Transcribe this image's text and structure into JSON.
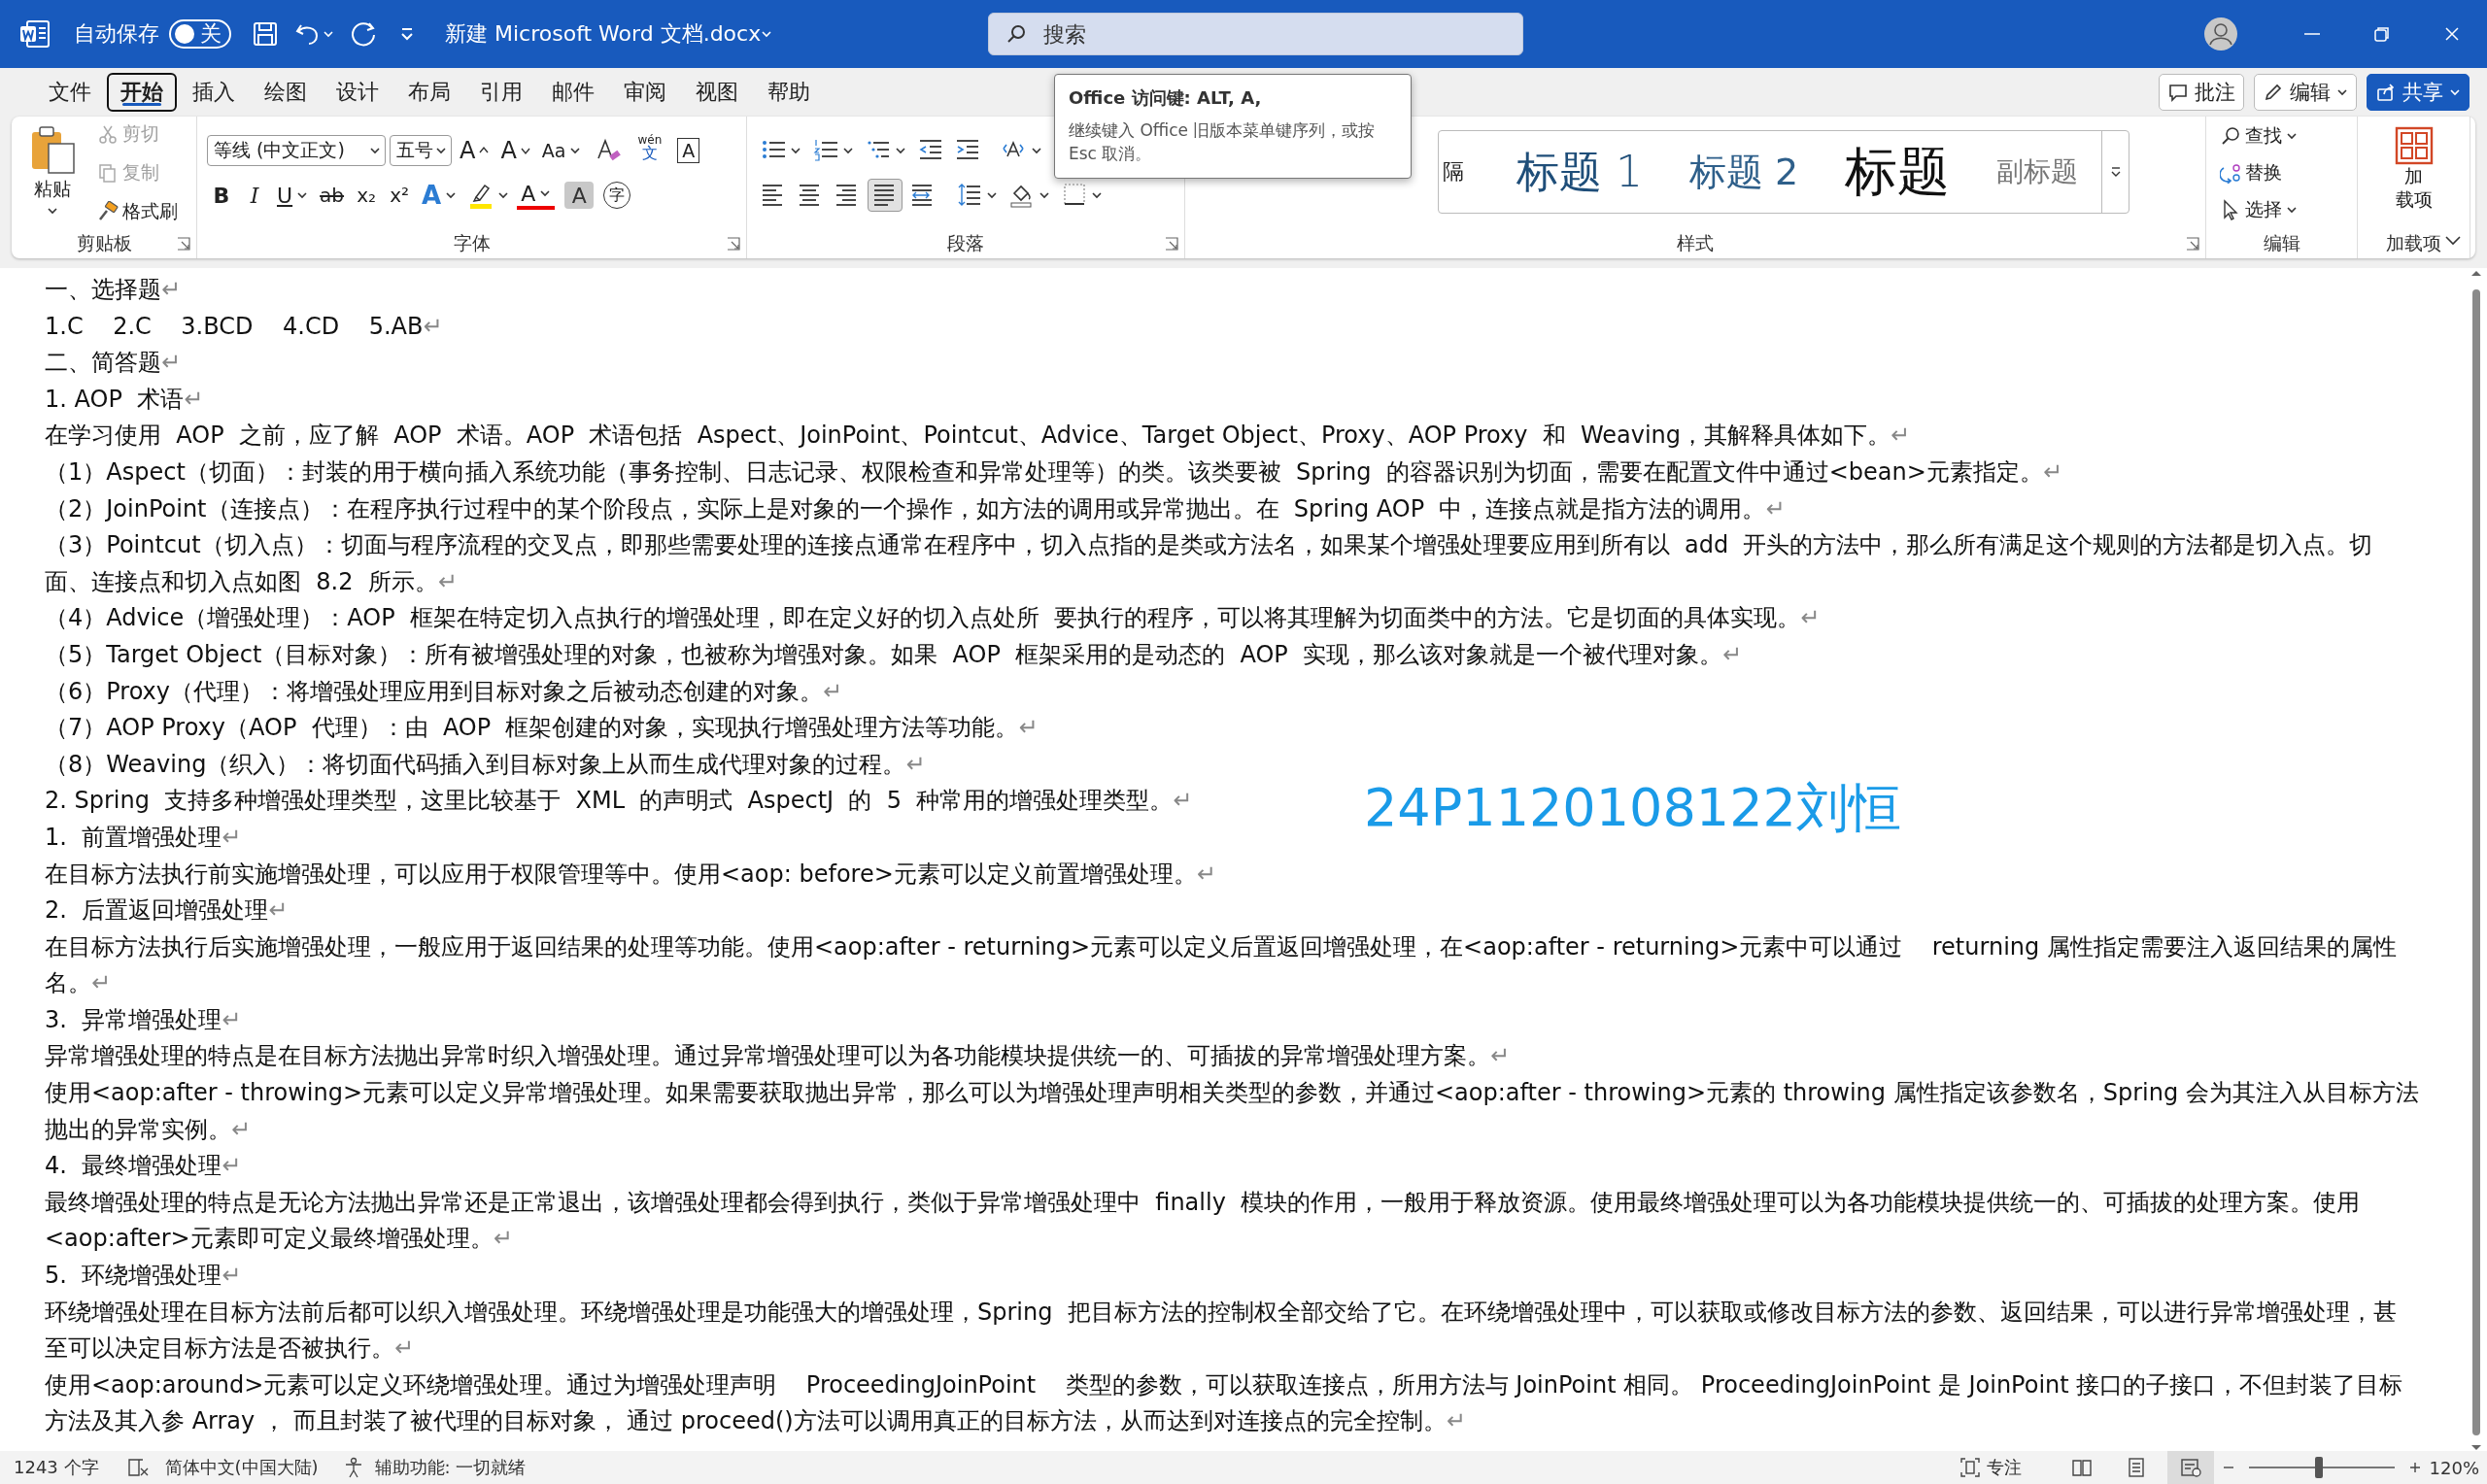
{
  "title_bar": {
    "autosave_label": "自动保存",
    "autosave": {
      "on": false,
      "label": "关"
    },
    "filename": "新建 Microsoft Word 文档.docx",
    "search": {
      "placeholder": "搜索"
    }
  },
  "menu_tabs": [
    {
      "label": "文件",
      "selected": false
    },
    {
      "label": "开始",
      "selected": true
    },
    {
      "label": "插入",
      "selected": false
    },
    {
      "label": "绘图",
      "selected": false
    },
    {
      "label": "设计",
      "selected": false
    },
    {
      "label": "布局",
      "selected": false
    },
    {
      "label": "引用",
      "selected": false
    },
    {
      "label": "邮件",
      "selected": false
    },
    {
      "label": "审阅",
      "selected": false
    },
    {
      "label": "视图",
      "selected": false
    },
    {
      "label": "帮助",
      "selected": false
    }
  ],
  "menu_buttons": [
    {
      "kind": "comment",
      "label": "批注"
    },
    {
      "kind": "edit",
      "label": "编辑"
    },
    {
      "kind": "share",
      "label": "共享"
    }
  ],
  "ribbon": {
    "clipboard": {
      "label": "剪贴板",
      "paste": "粘贴",
      "items": [
        {
          "kind": "cut",
          "label": "剪切",
          "disabled": true
        },
        {
          "kind": "copy",
          "label": "复制",
          "disabled": true
        },
        {
          "kind": "painter",
          "label": "格式刷",
          "disabled": false
        }
      ]
    },
    "font": {
      "label": "字体",
      "font_name": "等线 (中文正文)",
      "font_size": "五号",
      "row1": [
        {
          "kind": "grow",
          "label": "A"
        },
        {
          "kind": "shrink",
          "label": "A"
        },
        {
          "kind": "case",
          "label": "Aa"
        },
        {
          "kind": "clear"
        },
        {
          "kind": "phonetic",
          "top": "wén",
          "label": "文"
        },
        {
          "kind": "boxed",
          "label": "A"
        }
      ],
      "row2": [
        {
          "kind": "bold",
          "label": "B"
        },
        {
          "kind": "italic",
          "label": "I"
        },
        {
          "kind": "underline",
          "label": "U"
        },
        {
          "kind": "strike",
          "label": "ab"
        },
        {
          "kind": "sub",
          "label": "x₂"
        },
        {
          "kind": "sup",
          "label": "x²"
        },
        {
          "kind": "effects",
          "label": "A"
        },
        {
          "kind": "highlight"
        },
        {
          "kind": "color",
          "label": "A"
        },
        {
          "kind": "shade",
          "label": "A"
        },
        {
          "kind": "enclose",
          "label": "字"
        }
      ]
    },
    "paragraph": {
      "label": "段落",
      "row1": [
        {
          "kind": "bullets",
          "selected": false
        },
        {
          "kind": "numbering",
          "selected": false
        },
        {
          "kind": "multilevel",
          "selected": false
        },
        {
          "kind": "outdent",
          "selected": false
        },
        {
          "kind": "indent",
          "selected": false
        },
        {
          "kind": "direction",
          "selected": false
        }
      ],
      "row2": [
        {
          "kind": "left",
          "selected": false
        },
        {
          "kind": "center",
          "selected": false
        },
        {
          "kind": "right",
          "selected": false
        },
        {
          "kind": "justify",
          "selected": true
        },
        {
          "kind": "distributed",
          "selected": false
        },
        {
          "kind": "spacing",
          "selected": false
        },
        {
          "kind": "shading",
          "selected": false
        },
        {
          "kind": "borders",
          "selected": false
        }
      ]
    },
    "styles": {
      "label": "样式",
      "items": [
        {
          "kind": "cut",
          "label": "隔"
        },
        {
          "kind": "heading1",
          "label": "标题 1"
        },
        {
          "kind": "heading2",
          "label": "标题 2"
        },
        {
          "kind": "title",
          "label": "标题"
        },
        {
          "kind": "subtitle",
          "label": "副标题"
        }
      ]
    },
    "editing": {
      "label": "编辑",
      "items": [
        {
          "kind": "find",
          "label": "查找"
        },
        {
          "kind": "replace",
          "label": "替换"
        },
        {
          "kind": "select",
          "label": "选择"
        }
      ]
    },
    "addins": {
      "label": "加载项",
      "button": [
        "加",
        "载项"
      ]
    }
  },
  "tooltip": {
    "title": "Office 访问键: ALT, A,",
    "body": "继续键入 Office 旧版本菜单键序列，或按 Esc 取消。"
  },
  "document": {
    "paragraphs": [
      {
        "text": "一、选择题",
        "mark": "↵"
      },
      {
        "text": "1.C    2.C    3.BCD    4.CD    5.AB",
        "mark": "↵"
      },
      {
        "text": "二、简答题",
        "mark": "↵"
      },
      {
        "text": "1. AOP  术语",
        "mark": "↵"
      },
      {
        "text": "在学习使用  AOP  之前，应了解  AOP  术语。AOP  术语包括  Aspect、JoinPoint、Pointcut、Advice、Target Object、Proxy、AOP Proxy  和  Weaving，其解释具体如下。",
        "mark": "↵"
      },
      {
        "text": "（1）Aspect（切面）：封装的用于横向插入系统功能（事务控制、日志记录、权限检查和异常处理等）的类。该类要被  Spring  的容器识别为切面，需要在配置文件中通过<bean>元素指定。",
        "mark": "↵"
      },
      {
        "text": "（2）JoinPoint（连接点）：在程序执行过程中的某个阶段点，实际上是对象的一个操作，如方法的调用或异常抛出。在  Spring AOP  中，连接点就是指方法的调用。",
        "mark": "↵"
      },
      {
        "text": "（3）Pointcut（切入点）：切面与程序流程的交叉点，即那些需要处理的连接点通常在程序中，切入点指的是类或方法名，如果某个增强处理要应用到所有以  add  开头的方法中，那么所有满足这个规则的方法都是切入点。切面、连接点和切入点如图  8.2  所示。",
        "mark": "↵"
      },
      {
        "text": "（4）Advice（增强处理）：AOP  框架在特定切入点执行的增强处理，即在定义好的切入点处所  要执行的程序，可以将其理解为切面类中的方法。它是切面的具体实现。",
        "mark": "↵"
      },
      {
        "text": "（5）Target Object（目标对象）：所有被增强处理的对象，也被称为增强对象。如果  AOP  框架采用的是动态的  AOP  实现，那么该对象就是一个被代理对象。",
        "mark": "↵"
      },
      {
        "text": "（6）Proxy（代理）：将增强处理应用到目标对象之后被动态创建的对象。",
        "mark": "↵"
      },
      {
        "text": "（7）AOP Proxy（AOP  代理）：由  AOP  框架创建的对象，实现执行增强处理方法等功能。",
        "mark": "↵"
      },
      {
        "text": "（8）Weaving（织入）：将切面代码插入到目标对象上从而生成代理对象的过程。",
        "mark": "↵"
      },
      {
        "text": "2. Spring  支持多种增强处理类型，这里比较基于  XML  的声明式  AspectJ  的  5  种常用的增强处理类型。",
        "mark": "↵"
      },
      {
        "text": "1.  前置增强处理",
        "mark": "↵"
      },
      {
        "text": "在目标方法执行前实施增强处理，可以应用于权限管理等中。使用<aop: before>元素可以定义前置增强处理。",
        "mark": "↵"
      },
      {
        "text": "2.  后置返回增强处理",
        "mark": "↵"
      },
      {
        "text": "在目标方法执行后实施增强处理，一般应用于返回结果的处理等功能。使用<aop:after - returning>元素可以定义后置返回增强处理，在<aop:after - returning>元素中可以通过    returning 属性指定需要注入返回结果的属性名。",
        "mark": "↵"
      },
      {
        "text": "3.  异常增强处理",
        "mark": "↵"
      },
      {
        "text": "异常增强处理的特点是在目标方法抛出异常时织入增强处理。通过异常增强处理可以为各功能模块提供统一的、可插拔的异常增强处理方案。",
        "mark": "↵"
      },
      {
        "text": "使用<aop:after - throwing>元素可以定义异常增强处理。如果需要获取抛出异常，那么可以为增强处理声明相关类型的参数，并通过<aop:after - throwing>元素的 throwing 属性指定该参数名，Spring 会为其注入从目标方法抛出的异常实例。",
        "mark": "↵"
      },
      {
        "text": "4.  最终增强处理",
        "mark": "↵"
      },
      {
        "text": "最终增强处理的特点是无论方法抛出异常还是正常退出，该增强处理都会得到执行，类似于异常增强处理中  finally  模块的作用，一般用于释放资源。使用最终增强处理可以为各功能模块提供统一的、可插拔的处理方案。使用<aop:after>元素即可定义最终增强处理。",
        "mark": "↵"
      },
      {
        "text": "5.  环绕增强处理",
        "mark": "↵"
      },
      {
        "text": "环绕增强处理在目标方法前后都可以织入增强处理。环绕增强处理是功能强大的增强处理，Spring  把目标方法的控制权全部交给了它。在环绕增强处理中，可以获取或修改目标方法的参数、返回结果，可以进行异常增强处理，甚至可以决定目标方法是否被执行。",
        "mark": "↵"
      },
      {
        "text": "使用<aop:around>元素可以定义环绕增强处理。通过为增强处理声明    ProceedingJoinPoint    类型的参数，可以获取连接点，所用方法与 JoinPoint 相同。 ProceedingJoinPoint 是 JoinPoint 接口的子接口，不但封装了目标方法及其入参 Array ， 而且封装了被代理的目标对象， 通过 proceed()方法可以调用真正的目标方法，从而达到对连接点的完全控制。",
        "mark": "↵"
      }
    ],
    "text_box": "24P1120108122刘恒"
  },
  "status_bar": {
    "word_count": "1243 个字",
    "language": "简体中文(中国大陆)",
    "accessibility": "辅助功能: 一切就绪",
    "focus": "专注",
    "views": [
      {
        "kind": "read",
        "selected": false
      },
      {
        "kind": "print",
        "selected": false
      },
      {
        "kind": "web",
        "selected": true
      }
    ],
    "zoom": {
      "level": 0.48,
      "label": "120%"
    }
  }
}
